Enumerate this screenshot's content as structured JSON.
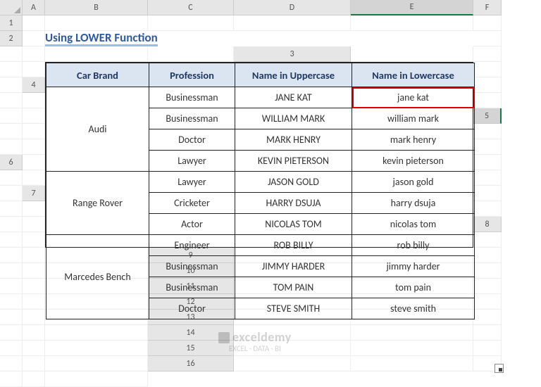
{
  "columns": [
    "A",
    "B",
    "C",
    "D",
    "E",
    "F"
  ],
  "rows": [
    "1",
    "2",
    "3",
    "4",
    "5",
    "6",
    "7",
    "8",
    "9",
    "10",
    "11",
    "12",
    "13",
    "14",
    "15",
    "16"
  ],
  "selected_col_index": 4,
  "selected_row_index": 4,
  "title": "Using LOWER Function",
  "headers": {
    "brand": "Car Brand",
    "profession": "Profession",
    "upper": "Name in Uppercase",
    "lower": "Name in Lowercase"
  },
  "table": [
    {
      "brand": "Audi",
      "rows": [
        {
          "profession": "Businessman",
          "upper": "JANE KAT",
          "lower": "jane kat"
        },
        {
          "profession": "Businessman",
          "upper": "WILLIAM MARK",
          "lower": "william mark"
        },
        {
          "profession": "Doctor",
          "upper": "MARK HENRY",
          "lower": "mark henry"
        },
        {
          "profession": "Lawyer",
          "upper": "KEVIN PIETERSON",
          "lower": "kevin pieterson"
        }
      ]
    },
    {
      "brand": "Range Rover",
      "rows": [
        {
          "profession": "Lawyer",
          "upper": "JASON GOLD",
          "lower": "jason gold"
        },
        {
          "profession": "Cricketer",
          "upper": "HARRY DSUJA",
          "lower": "harry dsuja"
        },
        {
          "profession": "Actor",
          "upper": "NICOLAS TOM",
          "lower": "nicolas tom"
        }
      ]
    },
    {
      "brand": "Marcedes Bench",
      "rows": [
        {
          "profession": "Engineer",
          "upper": "ROB BILLY",
          "lower": "rob billy"
        },
        {
          "profession": "Businessman",
          "upper": "JIMMY HARDER",
          "lower": "jimmy harder"
        },
        {
          "profession": "Businessman",
          "upper": "TOM PAIN",
          "lower": "tom pain"
        },
        {
          "profession": "Doctor",
          "upper": "STEVE SMITH",
          "lower": "steve smith"
        }
      ]
    }
  ],
  "highlight_flat": 0,
  "watermark": {
    "brand": "exceldemy",
    "tagline": "EXCEL · DATA · BI"
  }
}
